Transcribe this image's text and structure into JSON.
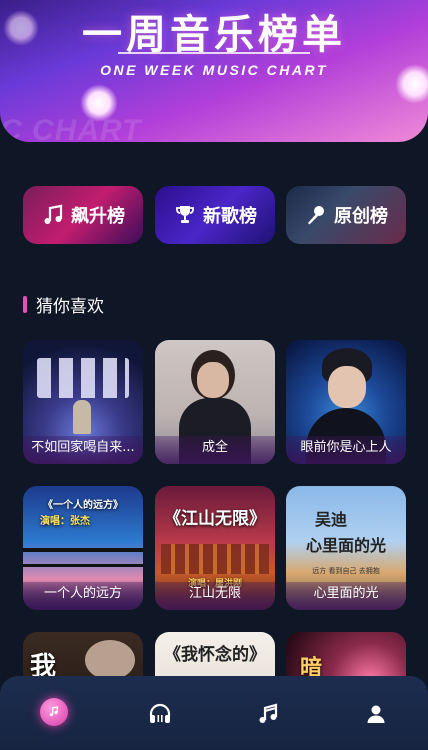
{
  "banner": {
    "title_cn": "一周音乐榜单",
    "title_en": "ONE WEEK MUSIC CHART",
    "ghost_text": "C CHART"
  },
  "categories": [
    {
      "label": "飙升榜",
      "icon": "music-note-icon"
    },
    {
      "label": "新歌榜",
      "icon": "trophy-icon"
    },
    {
      "label": "原创榜",
      "icon": "microphone-icon"
    }
  ],
  "section": {
    "title": "猜你喜欢"
  },
  "songs": [
    {
      "title": "不如回家喝自来..."
    },
    {
      "title": "成全"
    },
    {
      "title": "眼前你是心上人"
    },
    {
      "title": "一个人的远方",
      "overlay_line1": "《一个人的远方》",
      "overlay_line2": "演唱：张杰"
    },
    {
      "title": "江山无限",
      "overlay_line1": "《江山无限》",
      "overlay_line2": "演唱：屠洪刚"
    },
    {
      "title": "心里面的光",
      "overlay_line1": "吴迪",
      "overlay_line2": "心里面的光",
      "overlay_line3": "远方 看到自己 去拥抱"
    },
    {
      "title": "",
      "overlay_line1": "我"
    },
    {
      "title": "",
      "overlay_line1": "《我怀念的》"
    },
    {
      "title": "",
      "overlay_line1": "暗"
    }
  ],
  "nav": [
    {
      "name": "music-disc-icon",
      "active": true
    },
    {
      "name": "headphones-icon"
    },
    {
      "name": "music-notes-icon"
    },
    {
      "name": "user-icon"
    }
  ],
  "colors": {
    "background": "#0f1625",
    "accent_pink": "#e94fb8",
    "nav_bg": "#1c2d4f"
  }
}
